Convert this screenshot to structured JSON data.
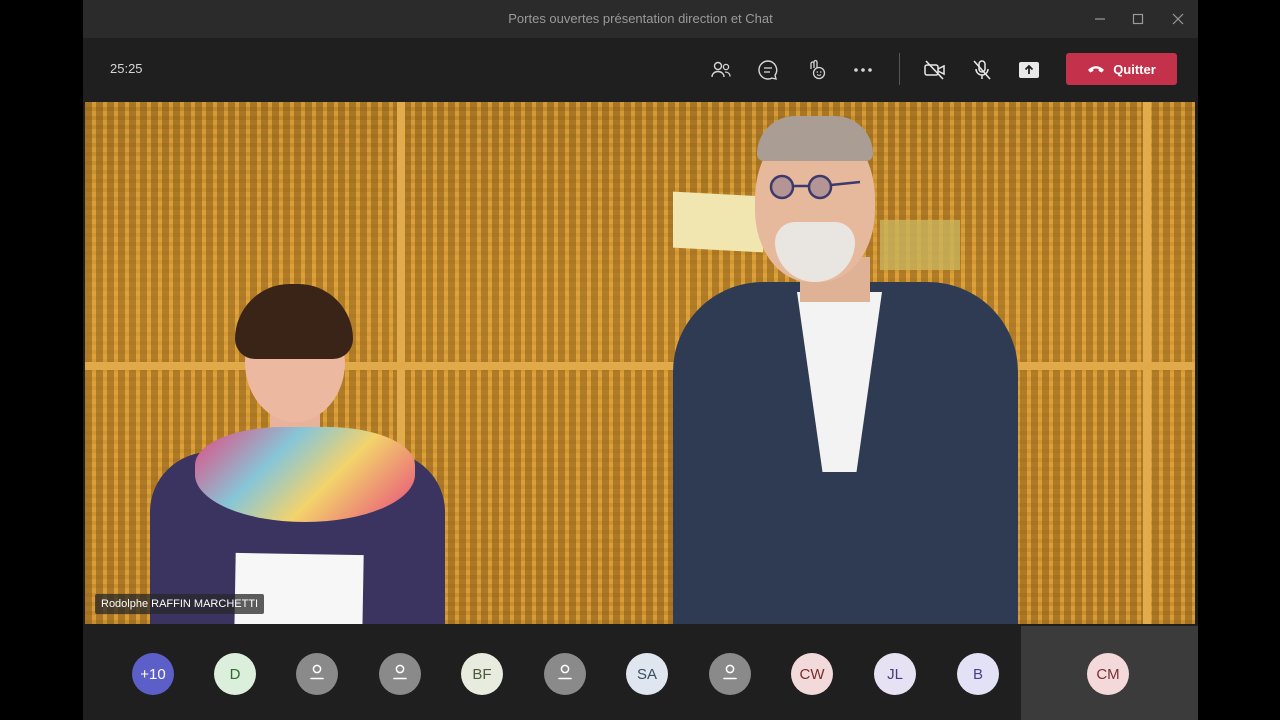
{
  "window": {
    "title": "Portes ouvertes présentation direction et Chat"
  },
  "toolbar": {
    "timer": "25:25",
    "leave_label": "Quitter",
    "icons": [
      "participants-icon",
      "chat-icon",
      "reactions-icon",
      "more-icon",
      "camera-off-icon",
      "mic-off-icon",
      "share-icon",
      "phone-hangup-icon"
    ]
  },
  "video": {
    "speaker_name": "Rodolphe RAFFIN MARCHETTI"
  },
  "participants": [
    {
      "initials": "+10",
      "bg": "#5b5fc7",
      "fg": "#ffffff"
    },
    {
      "initials": "D",
      "bg": "#dcefdc",
      "fg": "#2e6b2e"
    },
    {
      "initials": "",
      "bg": "#8a8a8a",
      "fg": "#ffffff",
      "icon": "person-icon"
    },
    {
      "initials": "",
      "bg": "#8a8a8a",
      "fg": "#ffffff",
      "icon": "person-icon"
    },
    {
      "initials": "BF",
      "bg": "#e7ecdf",
      "fg": "#4b5a3a"
    },
    {
      "initials": "",
      "bg": "#8a8a8a",
      "fg": "#ffffff",
      "icon": "person-icon"
    },
    {
      "initials": "SA",
      "bg": "#dfe6ef",
      "fg": "#3a4c63"
    },
    {
      "initials": "",
      "bg": "#8a8a8a",
      "fg": "#ffffff",
      "icon": "person-icon"
    },
    {
      "initials": "CW",
      "bg": "#f3dada",
      "fg": "#7a2b2b"
    },
    {
      "initials": "JL",
      "bg": "#e6e2f3",
      "fg": "#4b3a7a"
    },
    {
      "initials": "B",
      "bg": "#e3e1f5",
      "fg": "#4a3f8a"
    },
    {
      "initials": "CM",
      "bg": "#f3d9d9",
      "fg": "#7a2f35"
    }
  ],
  "colors": {
    "leave": "#c4314b",
    "accent": "#5b5fc7"
  }
}
